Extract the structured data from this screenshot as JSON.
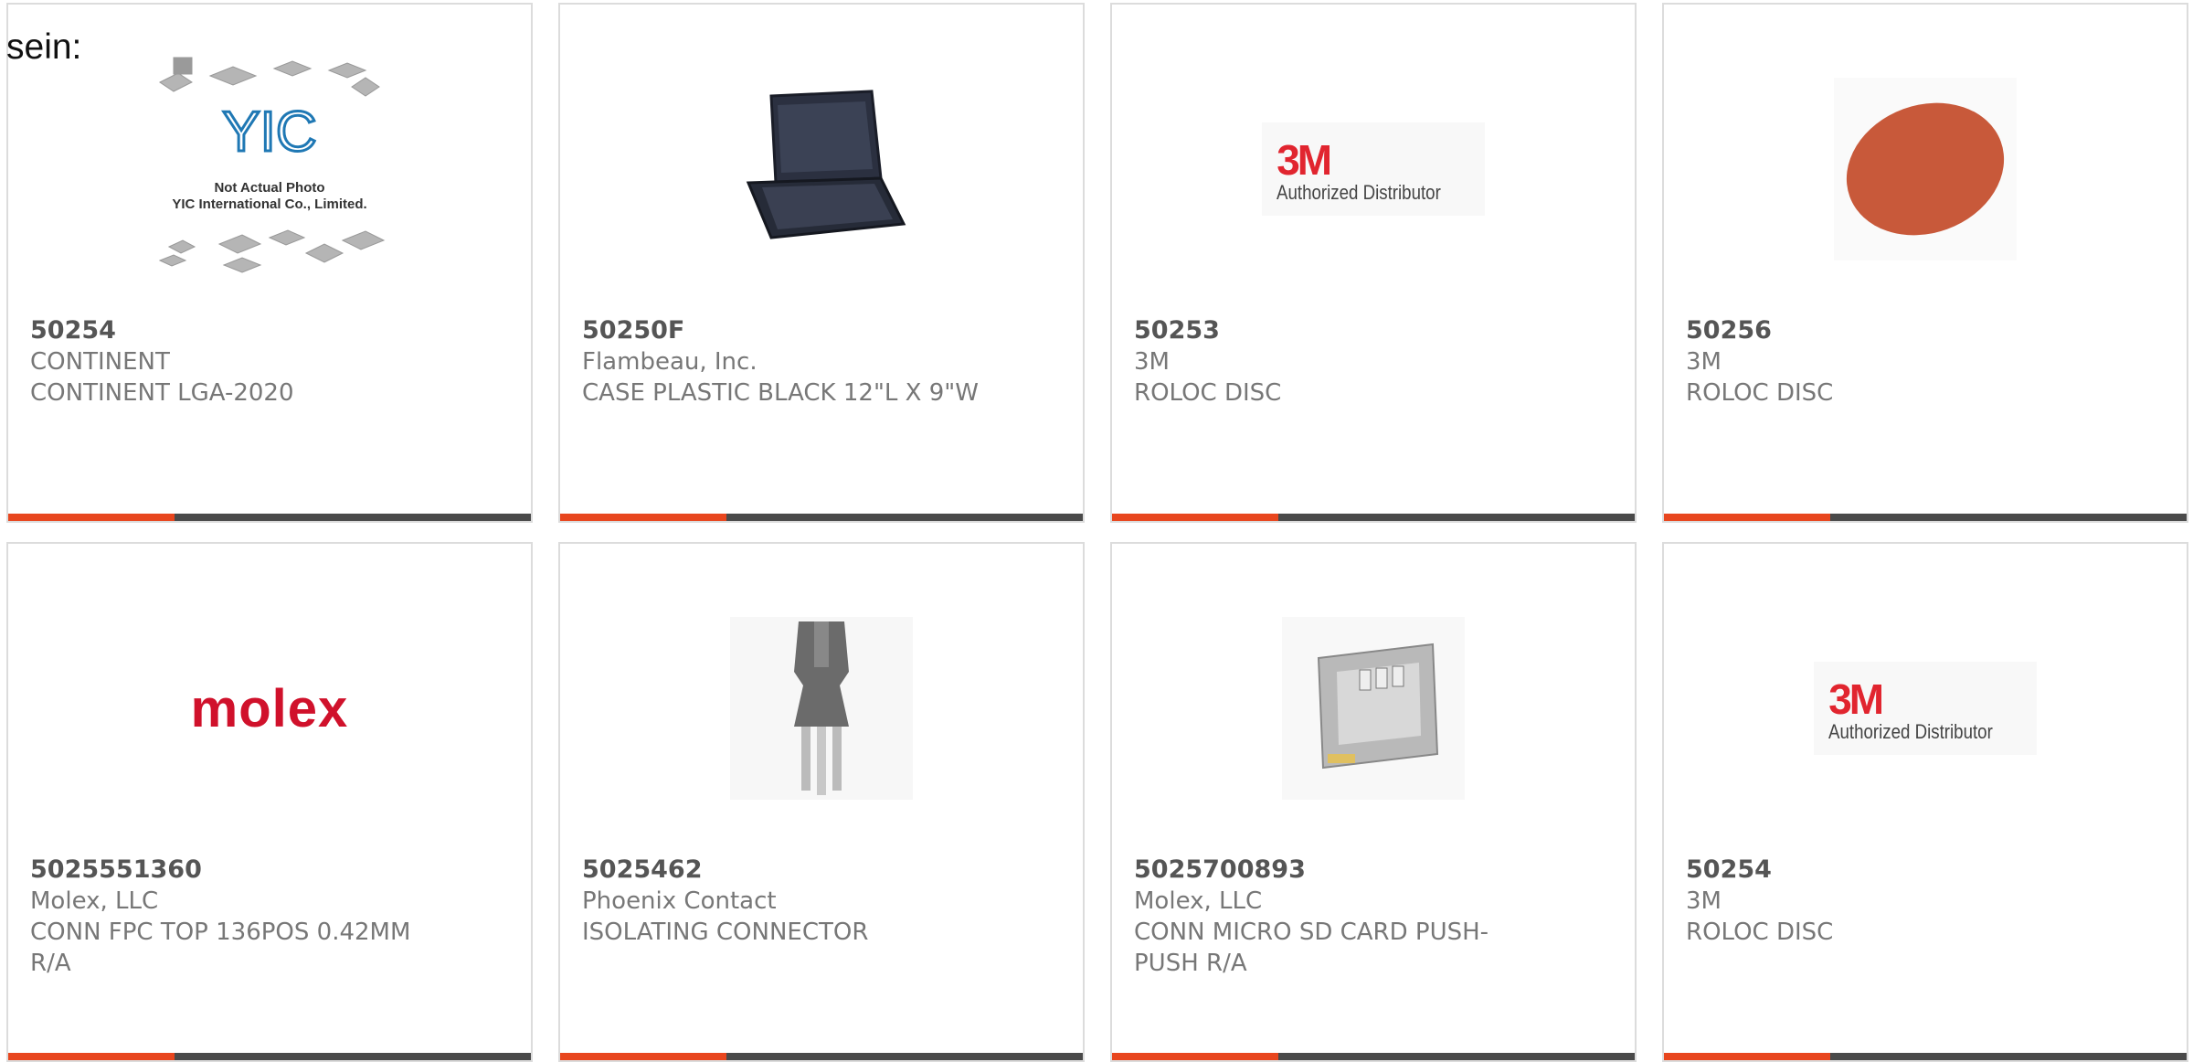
{
  "heading": "sein:",
  "colors": {
    "accent": "#e8461e",
    "bar": "#4a4a4a",
    "text": "#777777",
    "title": "#555555",
    "logo_red": "#e1252f"
  },
  "products": [
    {
      "part": "50254",
      "manufacturer": "CONTINENT",
      "description": "CONTINENT LGA-2020",
      "image": "yic-placeholder",
      "placeholder_line1": "Not Actual Photo",
      "placeholder_line2": "YIC International Co., Limited.",
      "placeholder_logo": "YIC"
    },
    {
      "part": "50250F",
      "manufacturer": "Flambeau, Inc.",
      "description": "CASE PLASTIC BLACK 12\"L X 9\"W",
      "image": "black-case"
    },
    {
      "part": "50253",
      "manufacturer": "3M",
      "description": "ROLOC DISC",
      "image": "3m-logo",
      "logo_mark": "3M",
      "logo_text": "Authorized Distributor"
    },
    {
      "part": "50256",
      "manufacturer": "3M",
      "description": "ROLOC DISC",
      "image": "orange-disc"
    },
    {
      "part": "5025551360",
      "manufacturer": "Molex, LLC",
      "description": "CONN FPC TOP 136POS 0.42MM R/A",
      "image": "molex-logo",
      "logo_mark": "molex"
    },
    {
      "part": "5025462",
      "manufacturer": "Phoenix Contact",
      "description": "ISOLATING CONNECTOR",
      "image": "gray-connector"
    },
    {
      "part": "5025700893",
      "manufacturer": "Molex, LLC",
      "description": "CONN MICRO SD CARD PUSH-PUSH R/A",
      "image": "sd-card-socket"
    },
    {
      "part": "50254",
      "manufacturer": "3M",
      "description": "ROLOC DISC",
      "image": "3m-logo",
      "logo_mark": "3M",
      "logo_text": "Authorized Distributor"
    }
  ]
}
